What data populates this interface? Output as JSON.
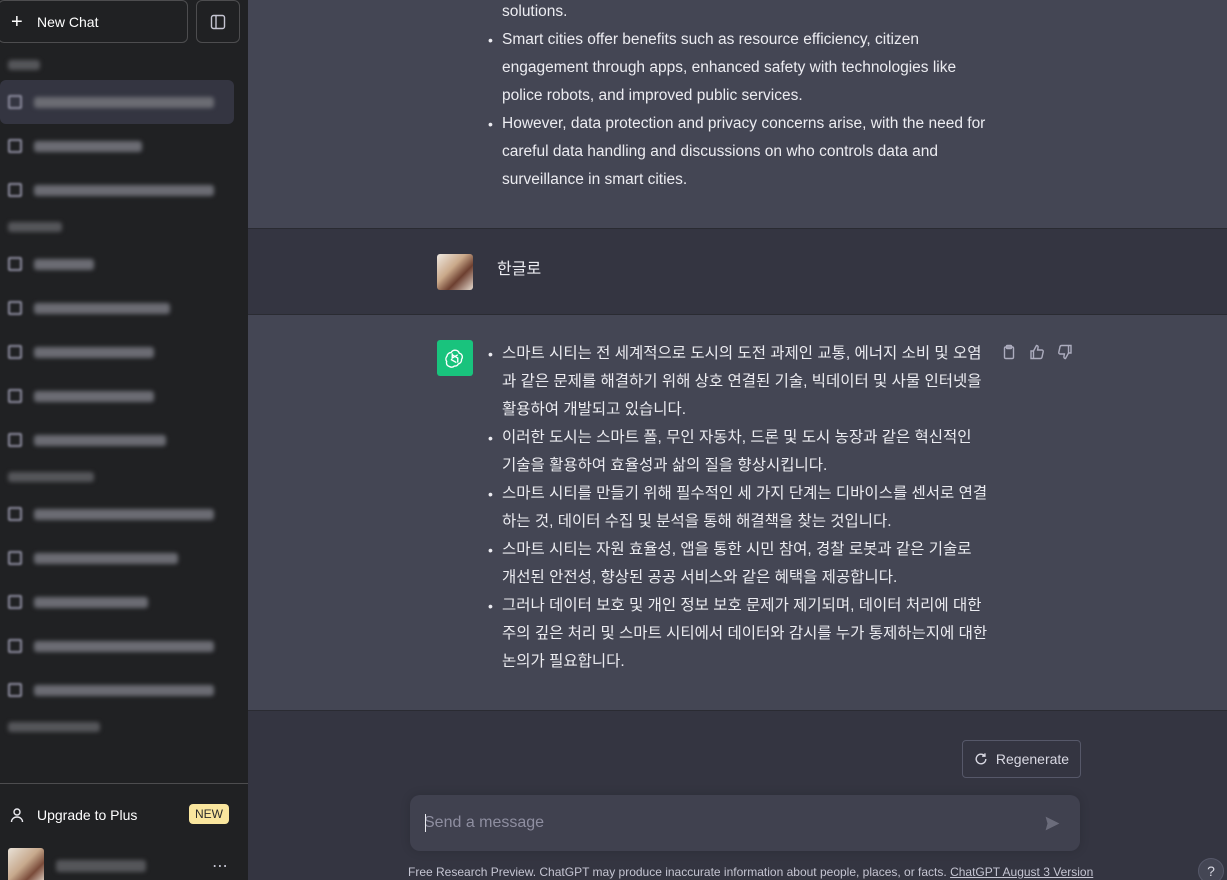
{
  "sidebar": {
    "new_chat_label": "New Chat",
    "upgrade_label": "Upgrade to Plus",
    "upgrade_badge": "NEW",
    "user_menu_icon": "⋯"
  },
  "conversation": {
    "prev_assistant_lines": [
      "solutions.",
      "Smart cities offer benefits such as resource efficiency, citizen engagement through apps, enhanced safety with technologies like police robots, and improved public services.",
      "However, data protection and privacy concerns arise, with the need for careful data handling and discussions on who controls data and surveillance in smart cities."
    ],
    "user_message": "한글로",
    "assistant_bullets": [
      "스마트 시티는 전 세계적으로 도시의 도전 과제인 교통, 에너지 소비 및 오염과 같은 문제를 해결하기 위해 상호 연결된 기술, 빅데이터 및 사물 인터넷을 활용하여 개발되고 있습니다.",
      "이러한 도시는 스마트 폴, 무인 자동차, 드론 및 도시 농장과 같은 혁신적인 기술을 활용하여 효율성과 삶의 질을 향상시킵니다.",
      "스마트 시티를 만들기 위해 필수적인 세 가지 단계는 디바이스를 센서로 연결하는 것, 데이터 수집 및 분석을 통해 해결책을 찾는 것입니다.",
      "스마트 시티는 자원 효율성, 앱을 통한 시민 참여, 경찰 로봇과 같은 기술로 개선된 안전성, 향상된 공공 서비스와 같은 혜택을 제공합니다.",
      "그러나 데이터 보호 및 개인 정보 보호 문제가 제기되며, 데이터 처리에 대한 주의 깊은 처리 및 스마트 시티에서 데이터와 감시를 누가 통제하는지에 대한 논의가 필요합니다."
    ]
  },
  "composer": {
    "regenerate_label": "Regenerate",
    "placeholder": "Send a message",
    "footer_text": "Free Research Preview. ChatGPT may produce inaccurate information about people, places, or facts. ",
    "footer_link": "ChatGPT August 3 Version",
    "help_label": "?"
  },
  "colors": {
    "sidebar_bg": "#202123",
    "main_bg": "#343541",
    "assistant_bg": "#444654",
    "gpt_avatar": "#19c37d",
    "badge_bg": "#fae69e"
  }
}
